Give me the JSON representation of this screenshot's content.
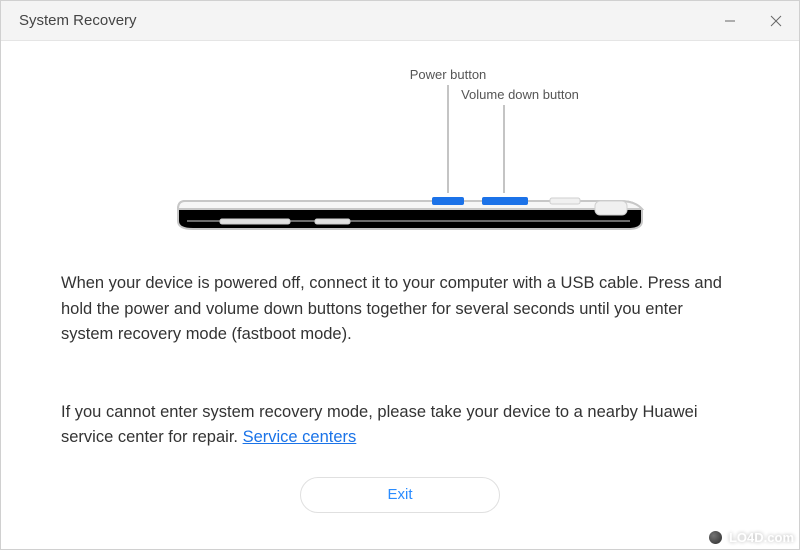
{
  "window": {
    "title": "System Recovery"
  },
  "diagram": {
    "power_label": "Power button",
    "volume_label": "Volume down button"
  },
  "instructions": "When your device is powered off, connect it to your computer with a USB cable. Press and hold the power and volume down buttons together for several seconds until you enter system recovery mode (fastboot mode).",
  "fallback": {
    "text_prefix": "If you cannot enter system recovery mode, please take your device to a nearby Huawei service center for repair. ",
    "link_label": "Service centers"
  },
  "buttons": {
    "exit": "Exit"
  },
  "watermark": "LO4D.com",
  "colors": {
    "highlight_blue": "#1b72e8",
    "link_blue": "#1a73e8",
    "exit_btn_text": "#2a8cff"
  }
}
